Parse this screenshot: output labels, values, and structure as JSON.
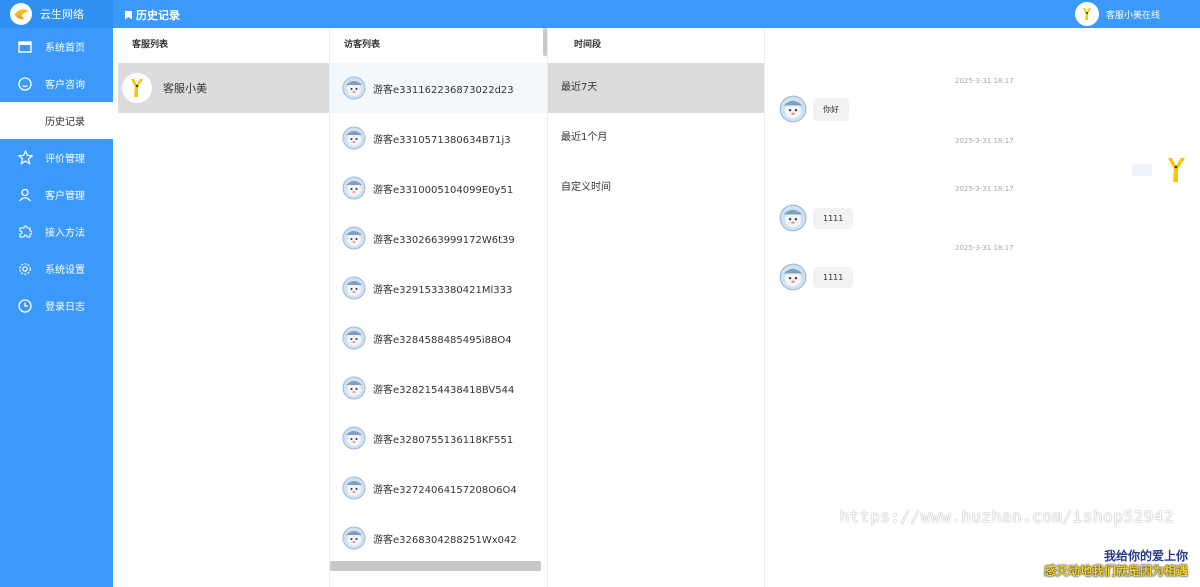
{
  "brand": {
    "title": "云生网络",
    "icon": "bird-logo-icon"
  },
  "header": {
    "page_title": "历史记录",
    "agent_status": "客服小美在线"
  },
  "sidebar": {
    "items": [
      {
        "label": "系统首页",
        "icon": "window-icon"
      },
      {
        "label": "客户咨询",
        "icon": "smile-icon"
      },
      {
        "label": "历史记录",
        "icon": "",
        "active": true
      },
      {
        "label": "评价管理",
        "icon": "star-icon"
      },
      {
        "label": "客户管理",
        "icon": "user-icon"
      },
      {
        "label": "接入方法",
        "icon": "puzzle-icon"
      },
      {
        "label": "系统设置",
        "icon": "gear-icon"
      },
      {
        "label": "登录日志",
        "icon": "clock-icon"
      }
    ]
  },
  "service_list": {
    "header": "客服列表",
    "items": [
      {
        "name": "客服小美"
      }
    ]
  },
  "visitor_list": {
    "header": "访客列表",
    "items": [
      "游客e331162236873022d23",
      "游客e3310571380634B71j3",
      "游客e3310005104099E0y51",
      "游客e3302663999172W6t39",
      "游客e3291533380421Ml333",
      "游客e3284588485495i88O4",
      "游客e3282154438418BV544",
      "游客e3280755136118KF551",
      "游客e32724064157208O6O4",
      "游客e3268304288251Wx042"
    ]
  },
  "periods": {
    "header": "时间段",
    "items": [
      "最近7天",
      "最近1个月",
      "自定义时间"
    ]
  },
  "chat": {
    "messages": [
      {
        "time": "2025-3-31 18:17",
        "from": "visitor",
        "text": "你好"
      },
      {
        "time": "2025-3-31 18:17",
        "from": "agent",
        "text": ""
      },
      {
        "time": "2025-3-31 18:17",
        "from": "visitor",
        "text": "1111"
      },
      {
        "time": "2025-3-31 18:17",
        "from": "visitor",
        "text": "1111"
      }
    ]
  },
  "watermark": "https://www.huzhan.com/ishop52942",
  "promo": {
    "line1": "我给你的爱上你",
    "line2": "感天动地我们就是因为相遇"
  },
  "colors": {
    "primary": "#3a99f9",
    "selected_bg": "#dcdcdc"
  }
}
